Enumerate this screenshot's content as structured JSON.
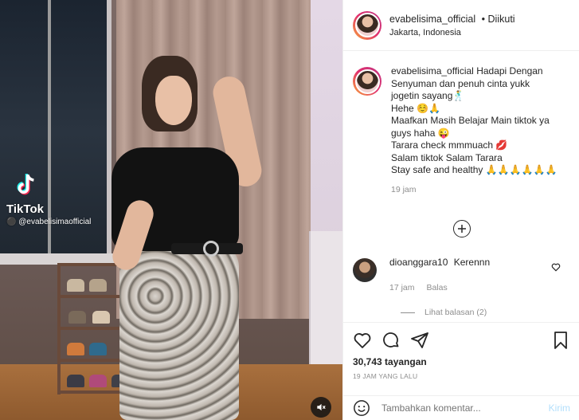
{
  "media": {
    "watermark_brand": "TikTok",
    "watermark_handle": "@evabelisimaofficial",
    "mute_icon": "volume-mute-icon"
  },
  "header": {
    "username": "evabelisima_official",
    "separator": "•",
    "follow_status": "Diikuti",
    "location": "Jakarta, Indonesia"
  },
  "caption": {
    "username": "evabelisima_official",
    "lines": [
      "Hadapi Dengan",
      "Senyuman dan penuh cinta yukk",
      "jogetin sayang🕺",
      "Hehe ☺️🙏",
      "Maafkan Masih Belajar Main tiktok ya",
      "guys haha 😜",
      "Tarara check mmmuach 💋",
      "Salam tiktok Salam Tarara",
      "Stay safe and healthy 🙏🙏🙏🙏🙏🙏"
    ],
    "time": "19 jam"
  },
  "load_more_icon": "plus-circle-icon",
  "comments": [
    {
      "username": "dioanggara10",
      "text": "Kerennn",
      "time": "17 jam",
      "reply_label": "Balas",
      "view_replies": "Lihat balasan (2)"
    }
  ],
  "actions": {
    "icons": [
      "heart-icon",
      "comment-icon",
      "share-icon",
      "bookmark-icon"
    ],
    "views": "30,743 tayangan",
    "posted": "19 JAM YANG LALU"
  },
  "add_comment": {
    "placeholder": "Tambahkan komentar...",
    "submit_label": "Kirim"
  },
  "colors": {
    "primary_text": "#262626",
    "secondary_text": "#8e8e8e",
    "border": "#efefef",
    "submit_disabled": "#b2dffc",
    "avatar_ring_start": "#f9a93a",
    "avatar_ring_end": "#c13584"
  }
}
